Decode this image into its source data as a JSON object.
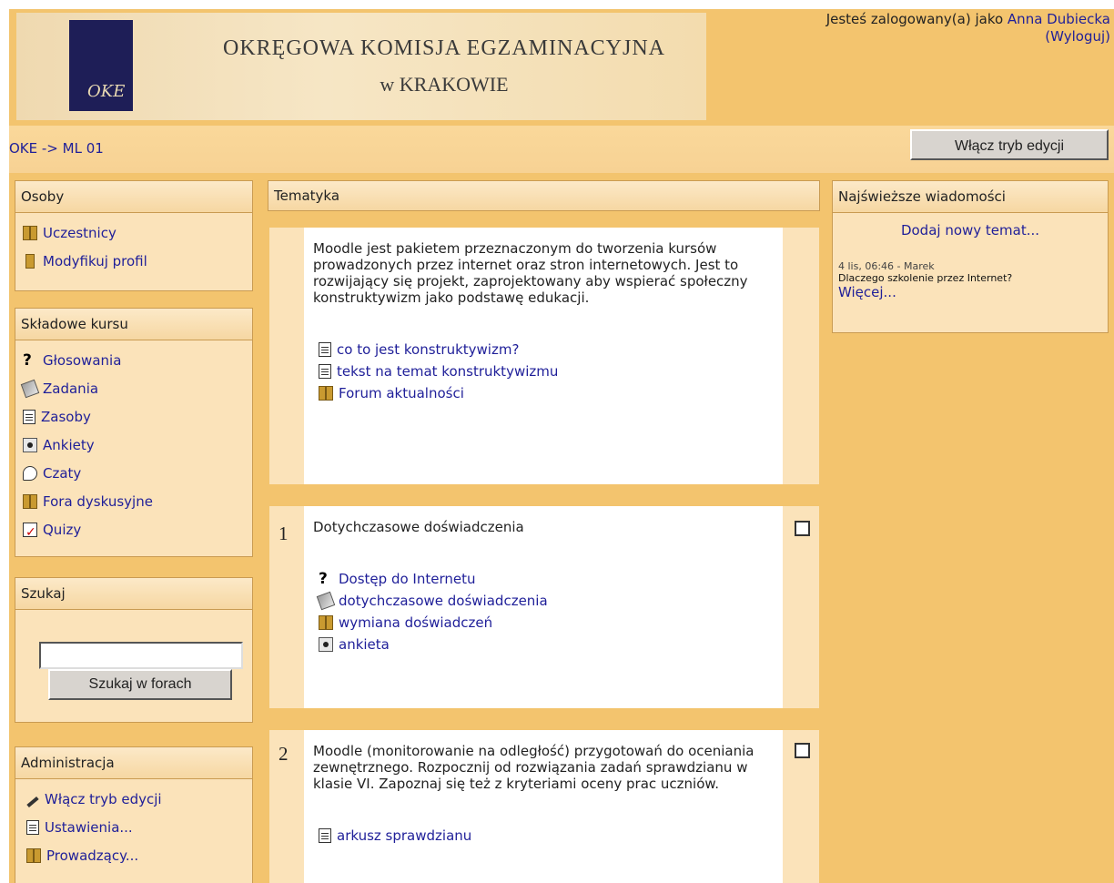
{
  "header": {
    "logo_text": "OKE",
    "title": "OKRĘGOWA KOMISJA EGZAMINACYJNA",
    "subtitle": "w KRAKOWIE",
    "login_prefix": "Jesteś zalogowany(a) jako ",
    "user_name": "Anna Dubiecka",
    "logout": "(Wyloguj)"
  },
  "navbar": {
    "breadcrumb": "OKE -> ML 01",
    "edit_button": "Włącz tryb edycji"
  },
  "people_block": {
    "title": "Osoby",
    "items": [
      {
        "label": "Uczestnicy",
        "icon": "people-icon"
      },
      {
        "label": "Modyfikuj profil",
        "icon": "person-icon"
      }
    ]
  },
  "course_block": {
    "title": "Składowe kursu",
    "items": [
      {
        "label": "Głosowania",
        "icon": "question-icon"
      },
      {
        "label": "Zadania",
        "icon": "assignment-icon"
      },
      {
        "label": "Zasoby",
        "icon": "document-icon"
      },
      {
        "label": "Ankiety",
        "icon": "radio-icon"
      },
      {
        "label": "Czaty",
        "icon": "chat-icon"
      },
      {
        "label": "Fora dyskusyjne",
        "icon": "people-icon"
      },
      {
        "label": "Quizy",
        "icon": "quiz-icon"
      }
    ]
  },
  "search_block": {
    "title": "Szukaj",
    "input_value": "",
    "button": "Szukaj w forach"
  },
  "admin_block": {
    "title": "Administracja",
    "items": [
      {
        "label": "Włącz tryb edycji",
        "icon": "pen-icon"
      },
      {
        "label": "Ustawienia...",
        "icon": "settings-icon"
      },
      {
        "label": "Prowadzący...",
        "icon": "people-icon"
      }
    ]
  },
  "main": {
    "topic_header": "Tematyka",
    "intro_text": "Moodle jest pakietem przeznaczonym do tworzenia kursów prowadzonych przez internet oraz stron internetowych. Jest to rozwijający się projekt, zaprojektowany aby wspierać społeczny konstruktywizm jako podstawę edukacji.",
    "intro_activities": [
      {
        "label": "co to jest konstruktywizm?",
        "icon": "document-icon"
      },
      {
        "label": "tekst na temat konstruktywizmu",
        "icon": "document-icon"
      },
      {
        "label": "Forum aktualności",
        "icon": "people-icon"
      }
    ],
    "sections": [
      {
        "number": "1",
        "summary": "Dotychczasowe doświadczenia",
        "activities": [
          {
            "label": "Dostęp do Internetu",
            "icon": "question-icon"
          },
          {
            "label": "dotychczasowe doświadczenia",
            "icon": "assignment-icon"
          },
          {
            "label": "wymiana doświadczeń",
            "icon": "people-icon"
          },
          {
            "label": "ankieta",
            "icon": "radio-icon"
          }
        ]
      },
      {
        "number": "2",
        "summary": "Moodle (monitorowanie na odległość) przygotowań do oceniania zewnętrznego. Rozpocznij od rozwiązania zadań sprawdzianu w klasie VI. Zapoznaj się też z kryteriami oceny prac uczniów.",
        "activities": [
          {
            "label": "arkusz sprawdzianu",
            "icon": "document-icon"
          }
        ]
      }
    ]
  },
  "news_block": {
    "title": "Najświeższe wiadomości",
    "add_link": "Dodaj nowy temat...",
    "post_meta": "4 lis, 06:46 - Marek",
    "post_title": "Dlaczego szkolenie przez Internet?",
    "more_link": "Więcej..."
  }
}
